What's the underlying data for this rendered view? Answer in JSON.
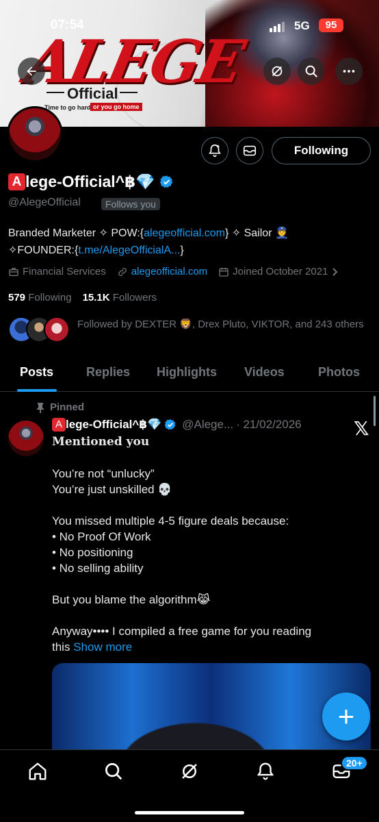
{
  "status_bar": {
    "time": "07:54",
    "network": "5G",
    "battery": "95"
  },
  "banner": {
    "brand": "ALEGE",
    "official": "Official",
    "tagline_a": "Time to go hard",
    "tagline_b": "or you go home"
  },
  "header_icons": {
    "back": "back-arrow-icon",
    "grok": "grok-icon",
    "search": "search-icon",
    "more": "more-icon"
  },
  "profile": {
    "following_button": "Following",
    "name_badge": "A",
    "name": "lege-Official^฿💎",
    "handle": "@AlegeOfficial",
    "follows_you": "Follows you",
    "bio": {
      "part1": "Branded Marketer ✧ POW:{",
      "link1": "alegeofficial.com",
      "part2": "} ✧ Sailor 👮",
      "part3": "✧FOUNDER:{",
      "link2": "t.me/AlegeOfficialA...",
      "part4": "}"
    },
    "category": "Financial Services",
    "website": "alegeofficial.com",
    "joined": "Joined October 2021",
    "following_count": "579",
    "following_label": "Following",
    "followers_count": "15.1K",
    "followers_label": "Followers",
    "followed_by": "Followed by DEXTER 🦁, Drex Pluto, VIKTOR, and 243 others"
  },
  "tabs": [
    "Posts",
    "Replies",
    "Highlights",
    "Videos",
    "Photos"
  ],
  "post": {
    "pinned_label": "Pinned",
    "name_badge": "A",
    "name": "lege-Official^฿💎",
    "handle": "@Alege...",
    "date": "· 21/02/2026",
    "mention": "Mentioned you",
    "lines": [
      "You’re not “unlucky”",
      "You’re just unskilled 💀",
      "",
      "You missed multiple 4-5 figure deals because:",
      "• No Proof Of Work",
      "• No positioning",
      "• No selling ability",
      "",
      "But you blame the algorithm😹",
      "",
      "Anyway•••• I compiled a free game for you reading"
    ],
    "last_line": "this",
    "show_more": "Show more"
  },
  "fab": "+",
  "bottom_nav": {
    "messages_badge": "20+"
  },
  "colors": {
    "accent": "#1d9bf0",
    "background": "#000000",
    "muted": "#71767b",
    "brand_red": "#d2121a"
  }
}
